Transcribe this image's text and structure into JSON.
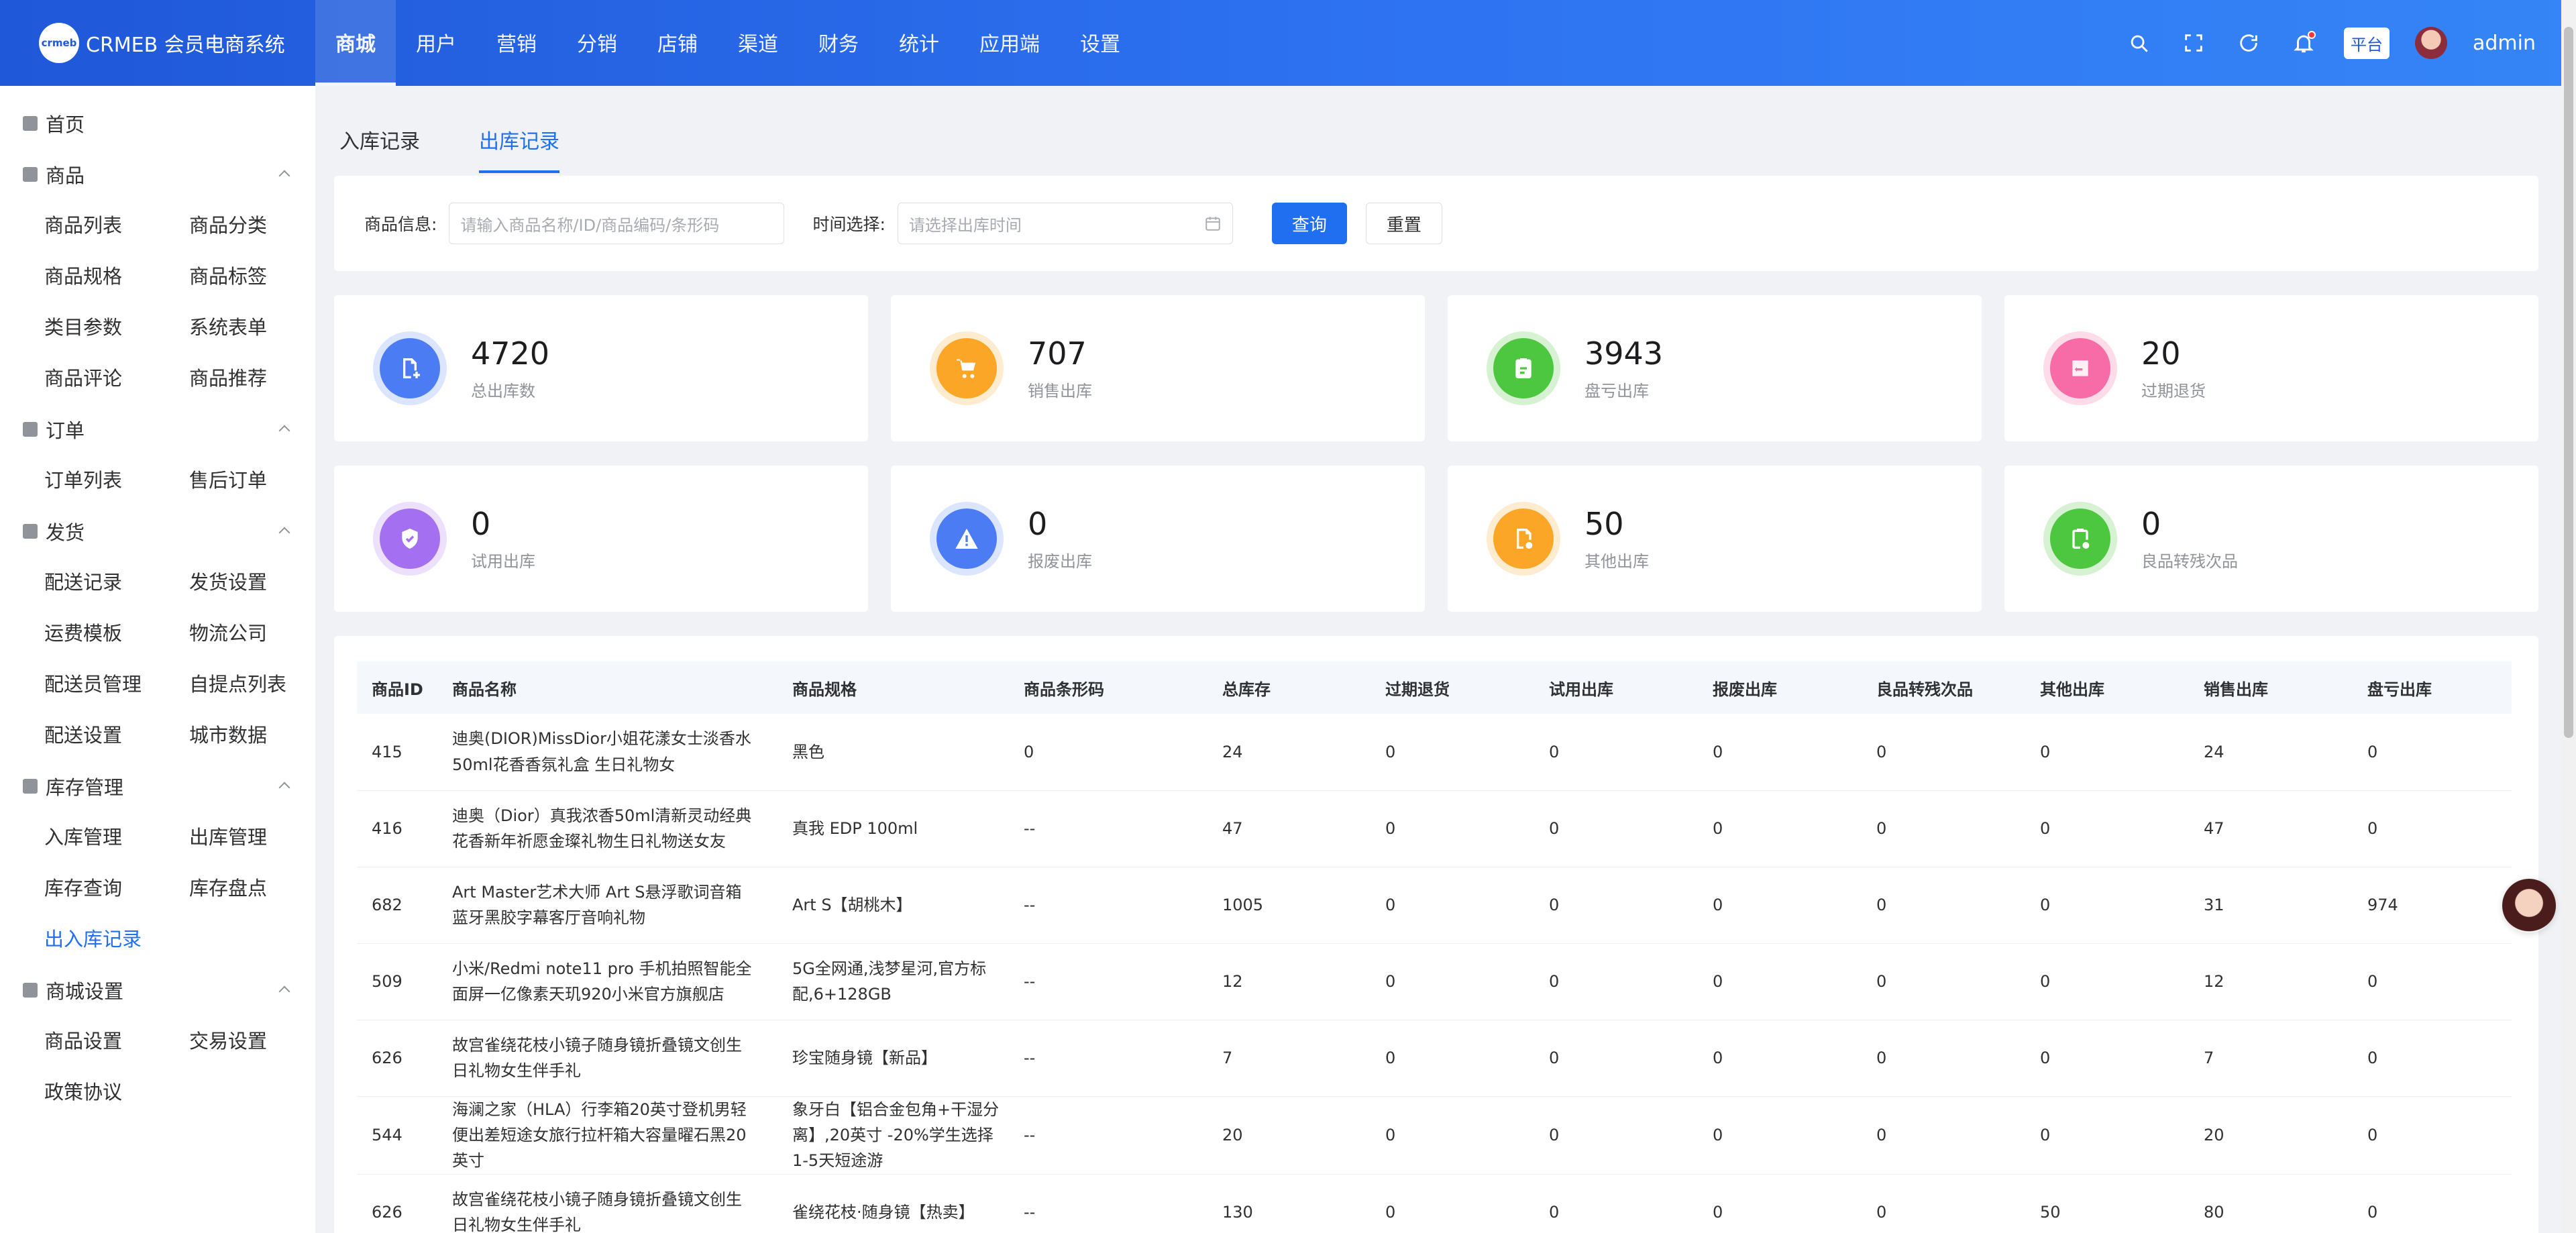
{
  "brand": {
    "logo_text": "crmeb",
    "name": "CRMEB 会员电商系统"
  },
  "topnav": [
    {
      "label": "商城",
      "active": true
    },
    {
      "label": "用户"
    },
    {
      "label": "营销"
    },
    {
      "label": "分销"
    },
    {
      "label": "店铺"
    },
    {
      "label": "渠道"
    },
    {
      "label": "财务"
    },
    {
      "label": "统计"
    },
    {
      "label": "应用端"
    },
    {
      "label": "设置"
    }
  ],
  "topright": {
    "platform": "平台",
    "admin": "admin"
  },
  "sidebar": {
    "home": "首页",
    "groups": [
      {
        "title": "商品",
        "items": [
          "商品列表",
          "商品分类",
          "商品规格",
          "商品标签",
          "类目参数",
          "系统表单",
          "商品评论",
          "商品推荐"
        ]
      },
      {
        "title": "订单",
        "items": [
          "订单列表",
          "售后订单"
        ]
      },
      {
        "title": "发货",
        "items": [
          "配送记录",
          "发货设置",
          "运费模板",
          "物流公司",
          "配送员管理",
          "自提点列表",
          "配送设置",
          "城市数据"
        ]
      },
      {
        "title": "库存管理",
        "items": [
          "入库管理",
          "出库管理",
          "库存查询",
          "库存盘点",
          "出入库记录"
        ]
      },
      {
        "title": "商城设置",
        "items": [
          "商品设置",
          "交易设置",
          "政策协议"
        ]
      }
    ],
    "active_item": "出入库记录"
  },
  "tabs": [
    {
      "label": "入库记录"
    },
    {
      "label": "出库记录",
      "active": true
    }
  ],
  "filter": {
    "product_label": "商品信息:",
    "product_placeholder": "请输入商品名称/ID/商品编码/条形码",
    "time_label": "时间选择:",
    "time_placeholder": "请选择出库时间",
    "query": "查询",
    "reset": "重置"
  },
  "stats": [
    {
      "value": "4720",
      "label": "总出库数",
      "color": "#4c7cf3",
      "ring": "#dbe5fd",
      "icon": "document-plus-icon"
    },
    {
      "value": "707",
      "label": "销售出库",
      "color": "#fba626",
      "ring": "#feecd0",
      "icon": "cart-icon"
    },
    {
      "value": "3943",
      "label": "盘亏出库",
      "color": "#4cc73f",
      "ring": "#d6f2d2",
      "icon": "clipboard-icon"
    },
    {
      "value": "20",
      "label": "过期退货",
      "color": "#f76ba6",
      "ring": "#fddbe9",
      "icon": "return-box-icon"
    },
    {
      "value": "0",
      "label": "试用出库",
      "color": "#a46ff0",
      "ring": "#ece0fc",
      "icon": "shield-check-icon"
    },
    {
      "value": "0",
      "label": "报废出库",
      "color": "#4c7cf3",
      "ring": "#dbe5fd",
      "icon": "warning-icon"
    },
    {
      "value": "50",
      "label": "其他出库",
      "color": "#fba626",
      "ring": "#feecd0",
      "icon": "document-gear-icon"
    },
    {
      "value": "0",
      "label": "良品转残次品",
      "color": "#4cc73f",
      "ring": "#d6f2d2",
      "icon": "clipboard-gear-icon"
    }
  ],
  "table": {
    "headers": [
      "商品ID",
      "商品名称",
      "商品规格",
      "商品条形码",
      "总库存",
      "过期退货",
      "试用出库",
      "报废出库",
      "良品转残次品",
      "其他出库",
      "销售出库",
      "盘亏出库"
    ],
    "rows": [
      [
        "415",
        "迪奥(DIOR)MissDior小姐花漾女士淡香水50ml花香香氛礼盒 生日礼物女",
        "黑色",
        "0",
        "24",
        "0",
        "0",
        "0",
        "0",
        "0",
        "24",
        "0"
      ],
      [
        "416",
        "迪奥（Dior）真我浓香50ml清新灵动经典花香新年祈愿金璨礼物生日礼物送女友",
        "真我 EDP 100ml",
        "--",
        "47",
        "0",
        "0",
        "0",
        "0",
        "0",
        "47",
        "0"
      ],
      [
        "682",
        "Art Master艺术大师 Art S悬浮歌词音箱蓝牙黑胶字幕客厅音响礼物",
        "Art S【胡桃木】",
        "--",
        "1005",
        "0",
        "0",
        "0",
        "0",
        "0",
        "31",
        "974"
      ],
      [
        "509",
        "小米/Redmi note11 pro 手机拍照智能全面屏一亿像素天玑920小米官方旗舰店",
        "5G全网通,浅梦星河,官方标配,6+128GB",
        "--",
        "12",
        "0",
        "0",
        "0",
        "0",
        "0",
        "12",
        "0"
      ],
      [
        "626",
        "故宫雀绕花枝小镜子随身镜折叠镜文创生日礼物女生伴手礼",
        "珍宝随身镜【新品】",
        "--",
        "7",
        "0",
        "0",
        "0",
        "0",
        "0",
        "7",
        "0"
      ],
      [
        "544",
        "海澜之家（HLA）行李箱20英寸登机男轻便出差短途女旅行拉杆箱大容量曜石黑20英寸",
        "象牙白【铝合金包角+干湿分离】,20英寸 -20%学生选择1-5天短途游",
        "--",
        "20",
        "0",
        "0",
        "0",
        "0",
        "0",
        "20",
        "0"
      ],
      [
        "626",
        "故宫雀绕花枝小镜子随身镜折叠镜文创生日礼物女生伴手礼",
        "雀绕花枝·随身镜【热卖】",
        "--",
        "130",
        "0",
        "0",
        "0",
        "0",
        "50",
        "80",
        "0"
      ]
    ]
  }
}
